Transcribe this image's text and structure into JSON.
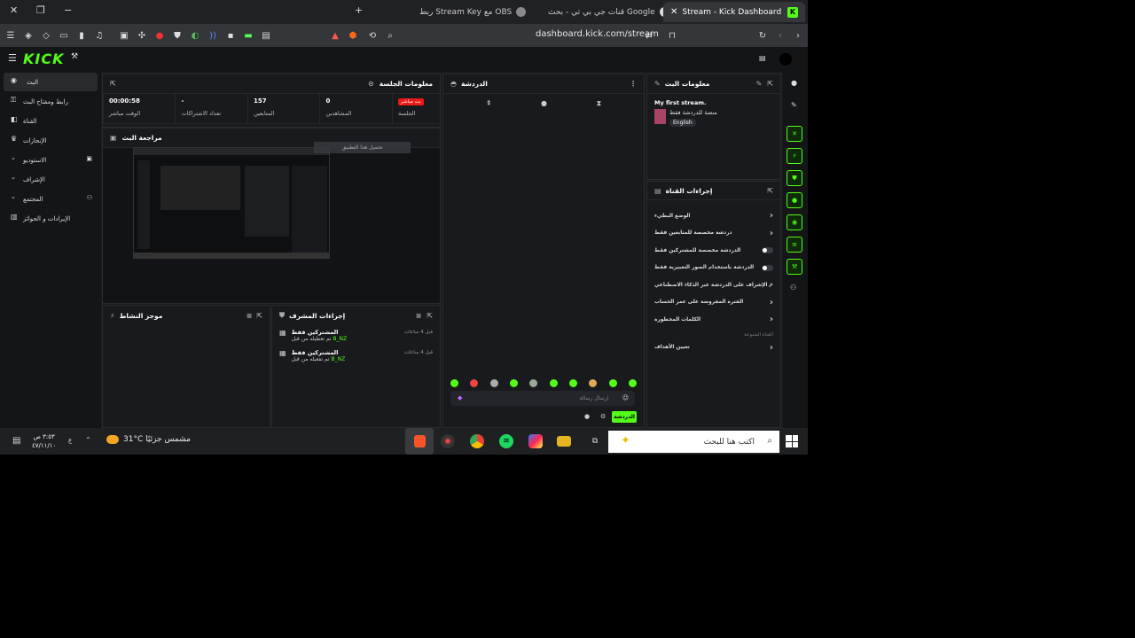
{
  "browser": {
    "tabs": [
      {
        "label": "ربط Stream Key مع OBS"
      },
      {
        "label": "قنات جي بي تي - بحث Google"
      },
      {
        "label": "Stream - Kick Dashboard"
      }
    ],
    "url": "dashboard.kick.com/stream"
  },
  "kick": {
    "logo": "KICK",
    "nav": [
      {
        "label": "البث",
        "icon": "broadcast-icon"
      },
      {
        "label": "رابط ومفتاح البث",
        "icon": "key-icon"
      },
      {
        "label": "القناة",
        "icon": "channel-icon"
      },
      {
        "label": "الإنجازات",
        "icon": "trophy-icon"
      },
      {
        "label": "الاستوديو",
        "icon": "studio-icon"
      },
      {
        "label": "الإشراف",
        "icon": "moderation-icon"
      },
      {
        "label": "المجتمع",
        "icon": "community-icon"
      },
      {
        "label": "الإيرادات و الجوائز",
        "icon": "revenue-icon"
      }
    ],
    "session": {
      "title": "معلومات الجلسة",
      "live_badge": "بث مباشر",
      "stats": [
        {
          "value": "",
          "label": "الجلسة"
        },
        {
          "value": "0",
          "label": "المشاهدين"
        },
        {
          "value": "157",
          "label": "المتابعين"
        },
        {
          "value": "-",
          "label": "تعداد الاشتراكات"
        },
        {
          "value": "00:00:58",
          "label": "الوقت مباشر"
        }
      ]
    },
    "preview": {
      "title": "مراجعة البث",
      "overlay": "تحميل هذا التطبيق"
    },
    "activity": {
      "title": "موجز النشاط"
    },
    "mod_actions": {
      "title": "إجراءات المشرف",
      "items": [
        {
          "title": "المشتركين فقط",
          "sub": "تم تعطيله من قبل",
          "user": "B_NZ",
          "time": "قبل 4 ساعات"
        },
        {
          "title": "المشتركين فقط",
          "sub": "تم تفعيله من قبل",
          "user": "B_NZ",
          "time": "قبل 4 ساعات"
        }
      ]
    },
    "chat": {
      "title": "الدردشة",
      "placeholder": "إرسال رسالة",
      "send": "الدردشة"
    },
    "stream_info": {
      "title": "معلومات البث",
      "stream_title": "My first stream.",
      "category": "منصة للدردشة فقط",
      "language": "English"
    },
    "channel_actions": {
      "title": "إجراءات القناة",
      "items": [
        {
          "label": "الوضع البطيء",
          "control": "arrow"
        },
        {
          "label": "دردشة مخصصة للمتابعين فقط",
          "control": "arrow"
        },
        {
          "label": "الدردشة مخصصة للمشتركين فقط",
          "control": "toggle"
        },
        {
          "label": "الدردشة باستخدام الصور التعبيرية فقط",
          "control": "toggle"
        },
        {
          "label": "الإشراف على الدردشة عبر الذكاء الاصطناعي",
          "control": "external"
        },
        {
          "label": "الفترة المفروضة على عمر الحساب",
          "control": "arrow"
        },
        {
          "label": "الكلمات المحظورة",
          "control": "arrow"
        }
      ],
      "section": "القناة المتبوعة",
      "extra": {
        "label": "تعيين الأهداف"
      }
    }
  },
  "taskbar": {
    "search": "اكتب هنا للبحث",
    "weather": "31°C  مشمس جزئيًا",
    "time": "٣:٥٣ ص",
    "date": "٤٧/١١/١٠"
  }
}
